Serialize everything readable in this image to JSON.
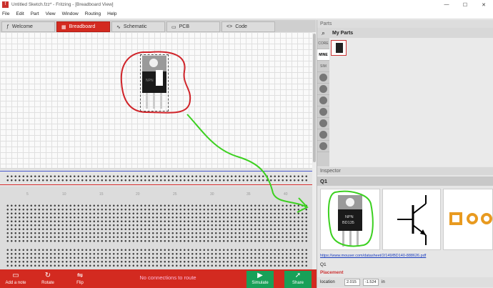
{
  "window": {
    "title": "Untitled Sketch.fzz* - Fritzing - [Breadboard View]",
    "min": "—",
    "max": "☐",
    "close": "✕"
  },
  "menu": [
    "File",
    "Edit",
    "Part",
    "View",
    "Window",
    "Routing",
    "Help"
  ],
  "tabs": [
    {
      "label": "Welcome",
      "icon": "ƒ"
    },
    {
      "label": "Breadboard",
      "icon": "▦"
    },
    {
      "label": "Schematic",
      "icon": "∿"
    },
    {
      "label": "PCB",
      "icon": "▭"
    },
    {
      "label": "Code",
      "icon": "<>"
    }
  ],
  "ruler_numbers": [
    "5",
    "10",
    "15",
    "20",
    "25",
    "30",
    "35",
    "40"
  ],
  "part_label": "NPN",
  "statusbar": {
    "add_note": "Add a note",
    "rotate": "Rotate",
    "flip": "Flip",
    "message": "No connections to route",
    "simulate": "Simulate",
    "share": "Share"
  },
  "parts": {
    "header": "Parts",
    "bin_title": "My Parts",
    "bins": [
      "CORE",
      "MINE",
      "SIM"
    ]
  },
  "inspector": {
    "header": "Inspector",
    "name": "Q1",
    "preview_part": "NPN BD135",
    "preview_label_top": "NPN",
    "preview_label_bottom": "BD135",
    "link": "https://www.mouser.com/datasheet/2/149/BD140-888626.pdf",
    "title_value": "Q1",
    "placement": "Placement",
    "location_label": "location",
    "location_x": "2.015",
    "location_y": "-1.524",
    "location_unit": "in"
  },
  "colors": {
    "accent": "#d32a20",
    "annotation_red": "#d0242a",
    "annotation_green": "#3cd020",
    "share": "#18a058"
  }
}
